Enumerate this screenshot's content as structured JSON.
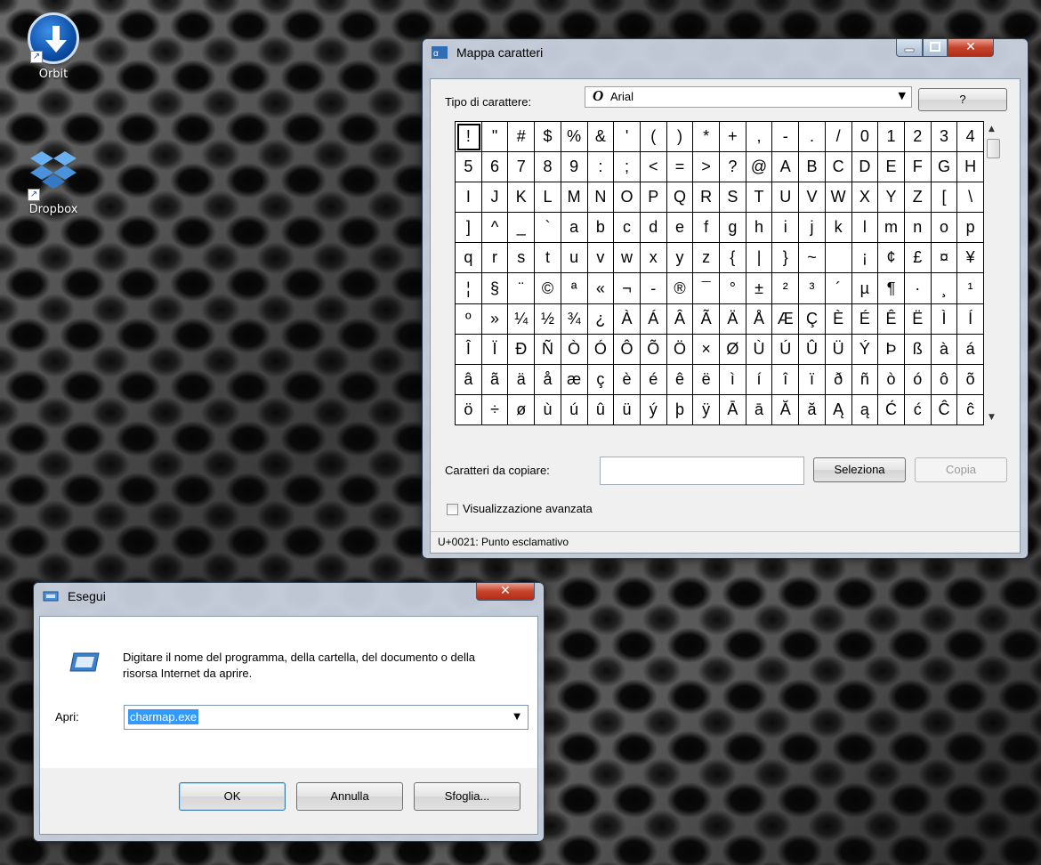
{
  "desktop": {
    "icons": [
      {
        "label": "Orbit"
      },
      {
        "label": "Dropbox"
      }
    ]
  },
  "charmap": {
    "title": "Mappa caratteri",
    "font_label": "Tipo di carattere:",
    "font_value": "Arial",
    "help_button": "?",
    "characters": [
      "!",
      "\"",
      "#",
      "$",
      "%",
      "&",
      "'",
      "(",
      ")",
      "*",
      "+",
      ",",
      "-",
      ".",
      "/",
      "0",
      "1",
      "2",
      "3",
      "4",
      "5",
      "6",
      "7",
      "8",
      "9",
      ":",
      ";",
      "<",
      "=",
      ">",
      "?",
      "@",
      "A",
      "B",
      "C",
      "D",
      "E",
      "F",
      "G",
      "H",
      "I",
      "J",
      "K",
      "L",
      "M",
      "N",
      "O",
      "P",
      "Q",
      "R",
      "S",
      "T",
      "U",
      "V",
      "W",
      "X",
      "Y",
      "Z",
      "[",
      "\\",
      "]",
      "^",
      "_",
      "`",
      "a",
      "b",
      "c",
      "d",
      "e",
      "f",
      "g",
      "h",
      "i",
      "j",
      "k",
      "l",
      "m",
      "n",
      "o",
      "p",
      "q",
      "r",
      "s",
      "t",
      "u",
      "v",
      "w",
      "x",
      "y",
      "z",
      "{",
      "|",
      "}",
      "~",
      " ",
      "¡",
      "¢",
      "£",
      "¤",
      "¥",
      "¦",
      "§",
      "¨",
      "©",
      "ª",
      "«",
      "¬",
      "-",
      "®",
      "¯",
      "°",
      "±",
      "²",
      "³",
      "´",
      "µ",
      "¶",
      "·",
      "¸",
      "¹",
      "º",
      "»",
      "¼",
      "½",
      "¾",
      "¿",
      "À",
      "Á",
      "Â",
      "Ã",
      "Ä",
      "Å",
      "Æ",
      "Ç",
      "È",
      "É",
      "Ê",
      "Ë",
      "Ì",
      "Í",
      "Î",
      "Ï",
      "Ð",
      "Ñ",
      "Ò",
      "Ó",
      "Ô",
      "Õ",
      "Ö",
      "×",
      "Ø",
      "Ù",
      "Ú",
      "Û",
      "Ü",
      "Ý",
      "Þ",
      "ß",
      "à",
      "á",
      "â",
      "ã",
      "ä",
      "å",
      "æ",
      "ç",
      "è",
      "é",
      "ê",
      "ë",
      "ì",
      "í",
      "î",
      "ï",
      "ð",
      "ñ",
      "ò",
      "ó",
      "ô",
      "õ",
      "ö",
      "÷",
      "ø",
      "ù",
      "ú",
      "û",
      "ü",
      "ý",
      "þ",
      "ÿ",
      "Ā",
      "ā",
      "Ă",
      "ă",
      "Ą",
      "ą",
      "Ć",
      "ć",
      "Ĉ",
      "ĉ"
    ],
    "copy_label": "Caratteri da copiare:",
    "copy_value": "",
    "select_button": "Seleziona",
    "copy_button": "Copia",
    "advanced_label": "Visualizzazione avanzata",
    "status": "U+0021: Punto esclamativo"
  },
  "run": {
    "title": "Esegui",
    "description": "Digitare il nome del programma, della cartella, del documento o della risorsa Internet da aprire.",
    "open_label": "Apri:",
    "open_value": "charmap.exe",
    "ok_button": "OK",
    "cancel_button": "Annulla",
    "browse_button": "Sfoglia..."
  },
  "colors": {
    "selection": "#3399ff",
    "close_button": "#c6432b"
  }
}
